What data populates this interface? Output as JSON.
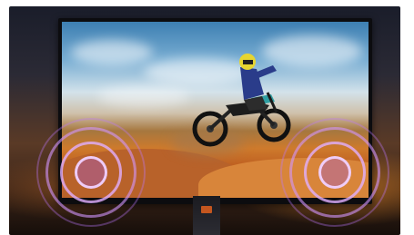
{
  "scene": {
    "subject": "",
    "colors": {
      "sky_top": "#3d7fb2",
      "sand": "#ce7a2c",
      "monitor_bezel": "#0c0c0f",
      "speaker_glow": "#c07bff",
      "stand_accent": "#c4561f"
    }
  },
  "icons": [
    "left-speaker-icon",
    "right-speaker-icon"
  ]
}
